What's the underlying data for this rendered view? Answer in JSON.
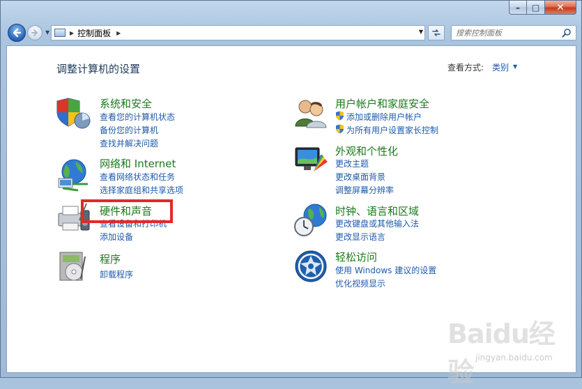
{
  "window": {
    "caption_buttons": {
      "minimize": "–",
      "maximize": "□",
      "close": "✕"
    }
  },
  "address_bar": {
    "breadcrumb": "控制面板",
    "search_placeholder": "搜索控制面板"
  },
  "header": {
    "title": "调整计算机的设置",
    "view_by_label": "查看方式:",
    "view_by_value": "类别"
  },
  "left_categories": [
    {
      "title": "系统和安全",
      "icon": "shield-pie-icon",
      "links": [
        "查看您的计算机状态",
        "备份您的计算机",
        "查找并解决问题"
      ]
    },
    {
      "title": "网络和 Internet",
      "icon": "network-globe-icon",
      "links": [
        "查看网络状态和任务",
        "选择家庭组和共享选项"
      ]
    },
    {
      "title": "硬件和声音",
      "icon": "printer-audio-icon",
      "links": [
        "查看设备和打印机",
        "添加设备"
      ]
    },
    {
      "title": "程序",
      "icon": "programs-disc-icon",
      "links": [
        "卸载程序"
      ]
    }
  ],
  "right_categories": [
    {
      "title": "用户帐户和家庭安全",
      "icon": "users-icon",
      "links": [
        "添加或删除用户帐户",
        "为所有用户设置家长控制"
      ]
    },
    {
      "title": "外观和个性化",
      "icon": "monitor-palette-icon",
      "links": [
        "更改主题",
        "更改桌面背景",
        "调整屏幕分辨率"
      ]
    },
    {
      "title": "时钟、语言和区域",
      "icon": "clock-globe-icon",
      "links": [
        "更改键盘或其他输入法",
        "更改显示语言"
      ]
    },
    {
      "title": "轻松访问",
      "icon": "ease-of-access-icon",
      "links": [
        "使用 Windows 建议的设置",
        "优化视频显示"
      ]
    }
  ],
  "watermark": {
    "logo": "Baidu经验",
    "url": "jingyan.baidu.com"
  },
  "colors": {
    "link": "#1e5aa8",
    "category_title": "#1a7a1a",
    "highlight_box": "#e12a2a"
  }
}
